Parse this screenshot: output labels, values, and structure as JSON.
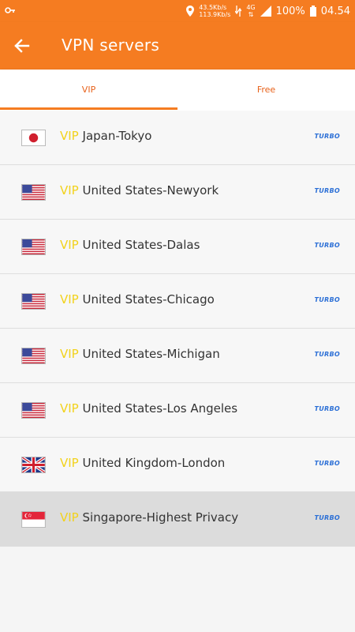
{
  "status_bar": {
    "speed_up": "43.5Kb/s",
    "speed_down": "113.9Kb/s",
    "network": "4G",
    "battery": "100%",
    "time": "04.54"
  },
  "app_bar": {
    "title": "VPN servers",
    "back_icon": "arrow-left-icon"
  },
  "tabs": [
    {
      "label": "VIP",
      "active": true
    },
    {
      "label": "Free",
      "active": false
    }
  ],
  "servers": [
    {
      "tier": "VIP",
      "name": "Japan-Tokyo",
      "badge": "TURBO",
      "flag": "jp"
    },
    {
      "tier": "VIP",
      "name": "United States-Newyork",
      "badge": "TURBO",
      "flag": "us"
    },
    {
      "tier": "VIP",
      "name": "United States-Dalas",
      "badge": "TURBO",
      "flag": "us"
    },
    {
      "tier": "VIP",
      "name": "United States-Chicago",
      "badge": "TURBO",
      "flag": "us"
    },
    {
      "tier": "VIP",
      "name": "United States-Michigan",
      "badge": "TURBO",
      "flag": "us"
    },
    {
      "tier": "VIP",
      "name": "United States-Los Angeles",
      "badge": "TURBO",
      "flag": "us"
    },
    {
      "tier": "VIP",
      "name": "United Kingdom-London",
      "badge": "TURBO",
      "flag": "gb"
    },
    {
      "tier": "VIP",
      "name": "Singapore-Highest Privacy",
      "badge": "TURBO",
      "flag": "sg",
      "selected": true
    }
  ],
  "colors": {
    "accent": "#f57c21",
    "vip": "#f2d21b",
    "turbo": "#2b6fd6"
  }
}
